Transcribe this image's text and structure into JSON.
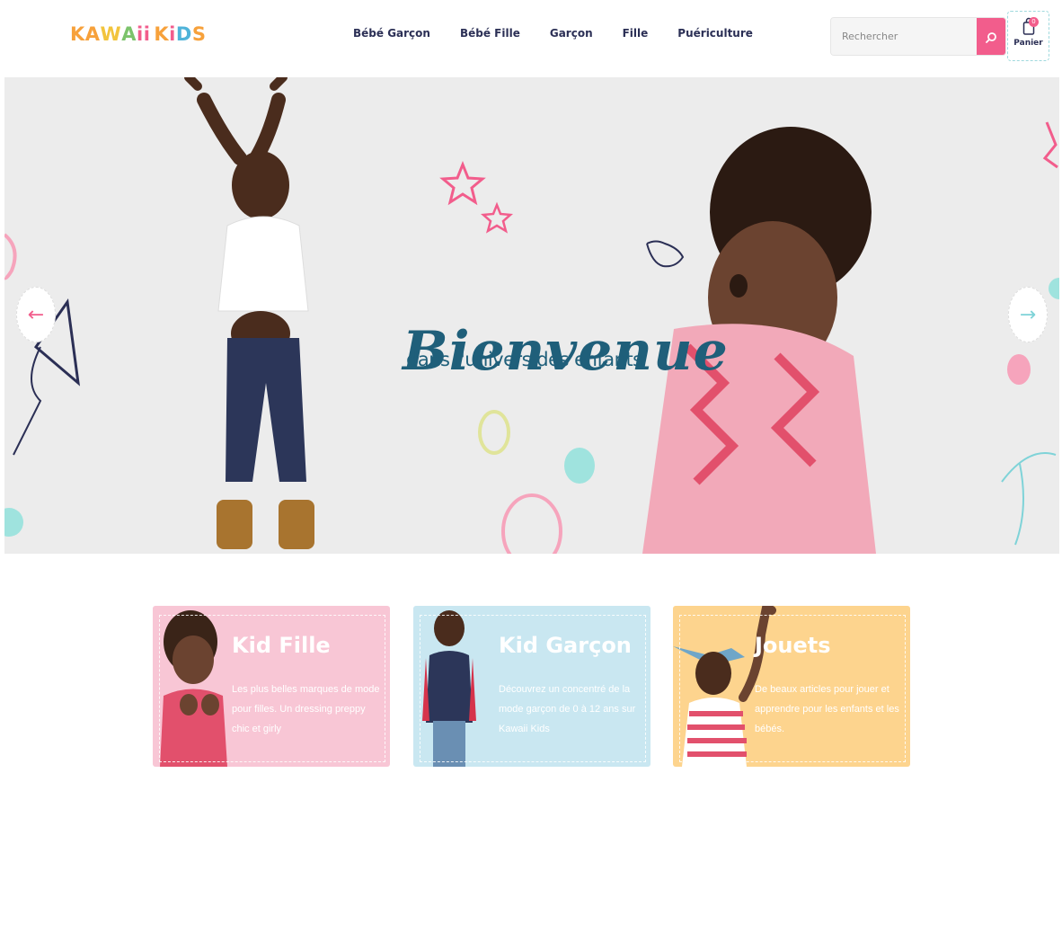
{
  "brand": {
    "logo_letters": [
      "K",
      "A",
      "W",
      "A",
      "i",
      "i",
      " ",
      "K",
      "i",
      "D",
      "S"
    ],
    "logo_colors": [
      "#f7a13b",
      "#f7a13b",
      "#f2c43c",
      "#7cc36b",
      "#f25d8c",
      "#f25d8c",
      " ",
      "#f7a13b",
      "#f25d8c",
      "#4fb3d9",
      "#f7a13b"
    ]
  },
  "nav": {
    "items": [
      "Bébé Garçon",
      "Bébé Fille",
      "Garçon",
      "Fille",
      "Puériculture"
    ]
  },
  "search": {
    "placeholder": "Rechercher",
    "icon": "search-icon"
  },
  "cart": {
    "count": "0",
    "label": "Panier",
    "icon": "shopping-bag-icon"
  },
  "hero": {
    "title": "Bienvenue",
    "subtitle": "dans l'univers des enfants",
    "prev_icon": "←",
    "next_icon": "→"
  },
  "categories": [
    {
      "title": "Kid Fille",
      "description": "Les plus belles marques de mode pour filles. Un dressing preppy chic et girly",
      "color": "#f8c6d5"
    },
    {
      "title": "Kid Garçon",
      "description": "Découvrez un concentré de la mode garçon de 0 à 12 ans sur Kawaii Kids",
      "color": "#c9e7f1"
    },
    {
      "title": "Jouets",
      "description": "De beaux articles pour jouer et apprendre pour les enfants et les bébés.",
      "color": "#fdd48e"
    }
  ],
  "colors": {
    "accent_pink": "#f25d8c",
    "nav_text": "#2b2f55",
    "hero_text": "#1f5f7a",
    "mint": "#7fd3d8"
  }
}
